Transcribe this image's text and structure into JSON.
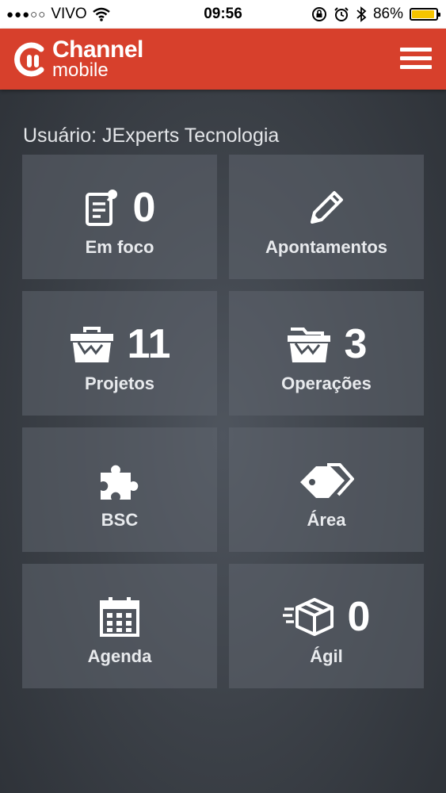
{
  "status_bar": {
    "signal": "●●●○○",
    "carrier": "VIVO",
    "time": "09:56",
    "battery_percent": "86%",
    "battery_level": 0.86
  },
  "app": {
    "name": "Channel",
    "subtitle": "mobile",
    "brand_color": "#d7402c"
  },
  "user_label": "Usuário: JExperts Tecnologia",
  "tiles": [
    {
      "label": "Em foco",
      "count": "0",
      "icon": "clipboard-icon"
    },
    {
      "label": "Apontamentos",
      "count": "",
      "icon": "pencil-icon"
    },
    {
      "label": "Projetos",
      "count": "11",
      "icon": "toolbox-icon"
    },
    {
      "label": "Operações",
      "count": "3",
      "icon": "folder-open-icon"
    },
    {
      "label": "BSC",
      "count": "",
      "icon": "puzzle-icon"
    },
    {
      "label": "Área",
      "count": "",
      "icon": "tags-icon"
    },
    {
      "label": "Agenda",
      "count": "",
      "icon": "calendar-icon"
    },
    {
      "label": "Ágil",
      "count": "0",
      "icon": "fast-box-icon"
    }
  ]
}
